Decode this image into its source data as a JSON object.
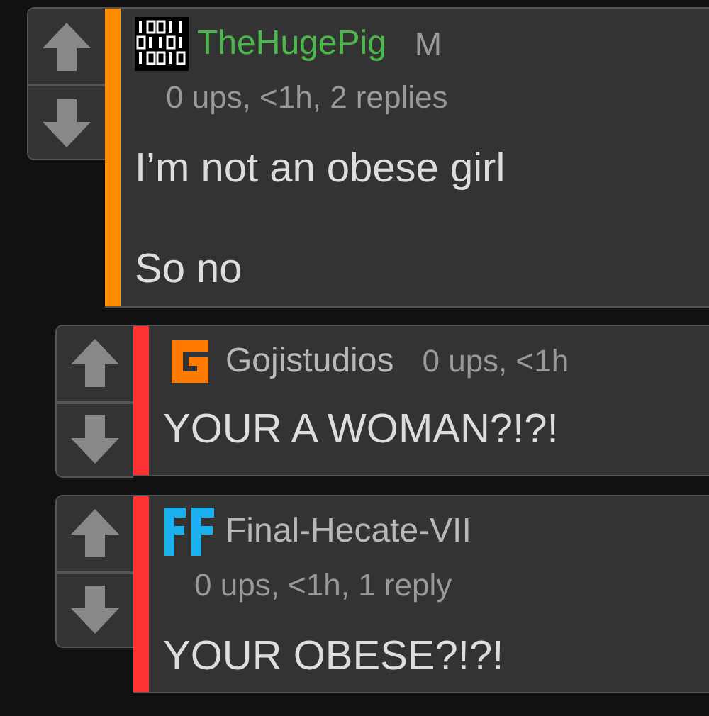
{
  "comments": [
    {
      "avatar": {
        "kind": "binary"
      },
      "author": "TheHugePig",
      "author_highlighted": true,
      "badge": "M",
      "meta": "0 ups, <1h, 2 replies",
      "stripe": {
        "color": "#ff8c00"
      },
      "body": [
        "I’m not an obese girl",
        "So no"
      ],
      "children": [
        {
          "avatar": {
            "kind": "g-logo"
          },
          "author": "Gojistudios",
          "author_highlighted": false,
          "meta": "0 ups, <1h",
          "stripe": {
            "color": "#ff3333"
          },
          "body": [
            "YOUR A WOMAN?!?!"
          ]
        },
        {
          "avatar": {
            "kind": "ff-logo"
          },
          "author": "Final-Hecate-VII",
          "author_highlighted": false,
          "meta": "0 ups, <1h, 1 reply",
          "stripe": {
            "color": "#ff3333"
          },
          "body": [
            "YOUR OBESE?!?!"
          ]
        }
      ]
    }
  ]
}
